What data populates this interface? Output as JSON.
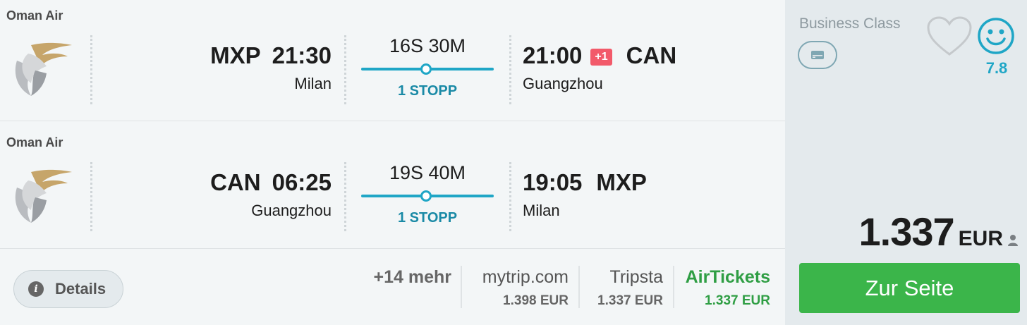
{
  "legs": [
    {
      "airline": "Oman Air",
      "dep_code": "MXP",
      "dep_time": "21:30",
      "dep_city": "Milan",
      "duration": "16S 30M",
      "stops": "1 STOPP",
      "arr_time": "21:00",
      "day_offset": "+1",
      "arr_code": "CAN",
      "arr_city": "Guangzhou"
    },
    {
      "airline": "Oman Air",
      "dep_code": "CAN",
      "dep_time": "06:25",
      "dep_city": "Guangzhou",
      "duration": "19S 40M",
      "stops": "1 STOPP",
      "arr_time": "19:05",
      "arr_code": "MXP",
      "arr_city": "Milan"
    }
  ],
  "details_label": "Details",
  "more_providers": "+14 mehr",
  "providers": [
    {
      "name": "mytrip.com",
      "price": "1.398 EUR"
    },
    {
      "name": "Tripsta",
      "price": "1.337 EUR"
    },
    {
      "name": "AirTickets",
      "price": "1.337 EUR"
    }
  ],
  "cabin_class": "Business Class",
  "rating": "7.8",
  "price_amount": "1.337",
  "price_currency": "EUR",
  "cta_label": "Zur Seite",
  "colors": {
    "accent": "#1fa6c6",
    "cta": "#3bb54a",
    "badge": "#f25a6a",
    "highlight_provider": "#2f9e44"
  },
  "icons": [
    "airline-logo-icon",
    "info-icon",
    "cabin-class-icon",
    "heart-icon",
    "smiley-icon",
    "person-icon"
  ]
}
